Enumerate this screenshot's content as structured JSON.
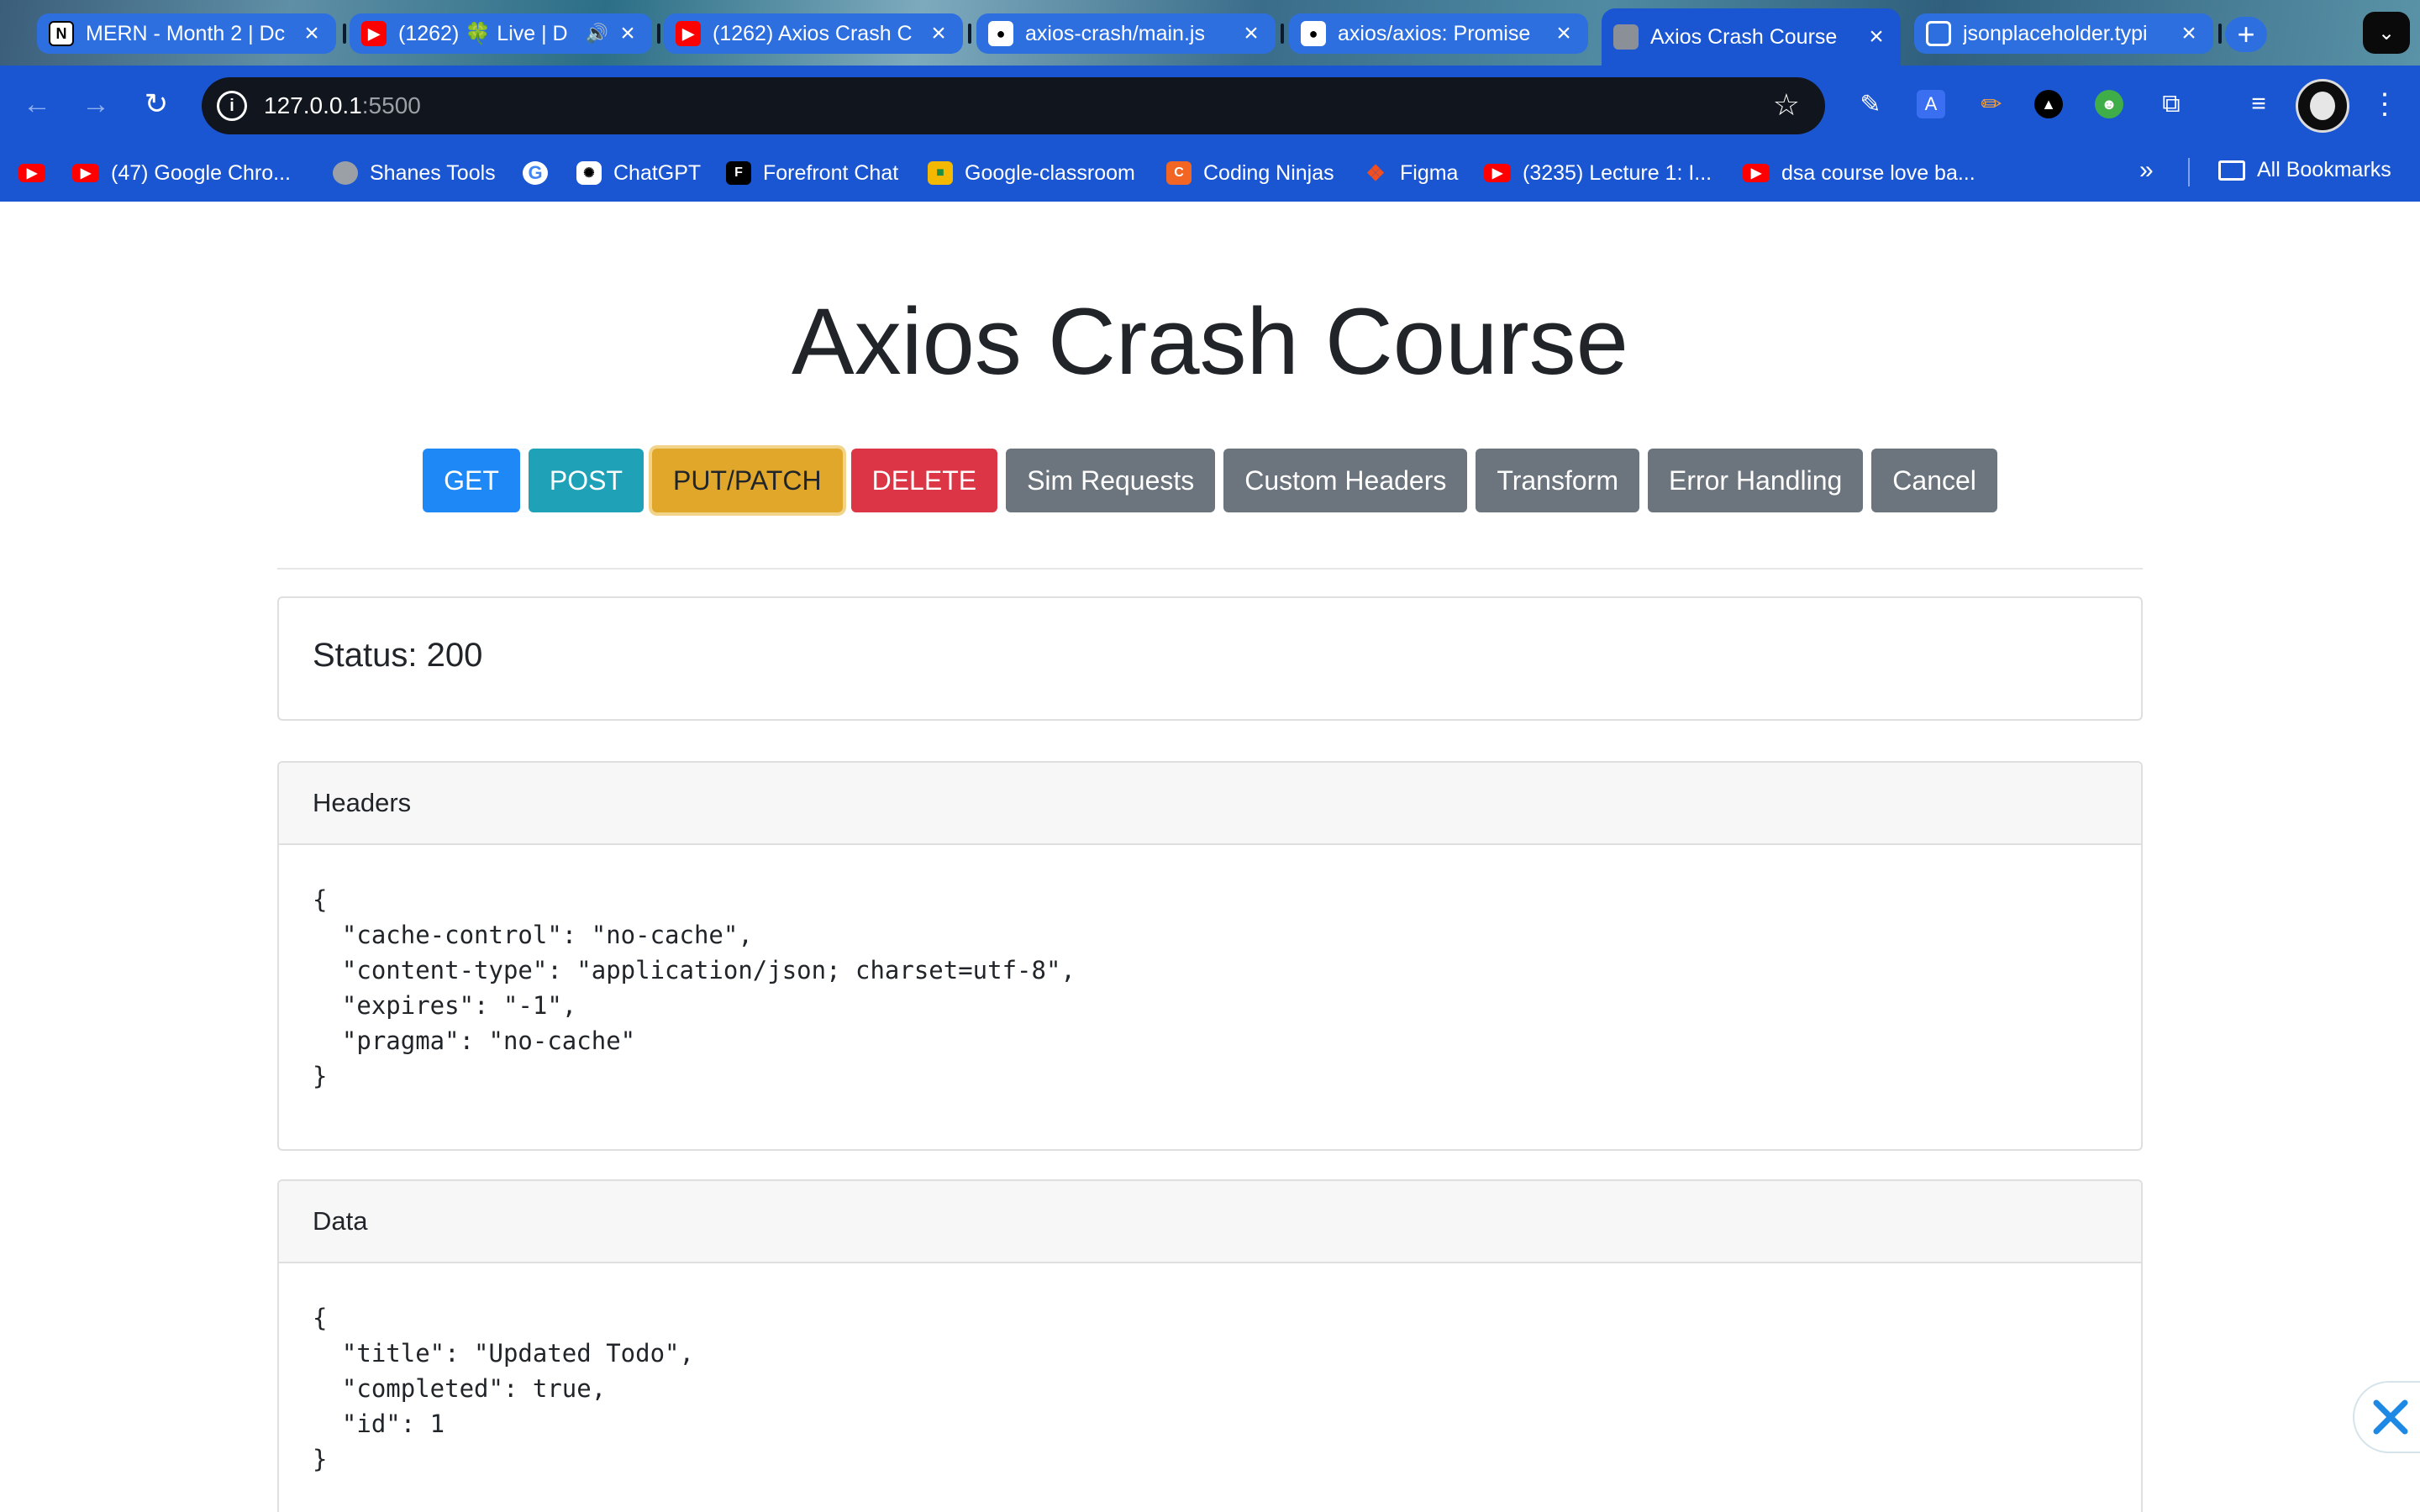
{
  "browser": {
    "tabs": [
      {
        "title": "MERN - Month 2 | Dc",
        "icon": "notion-icon"
      },
      {
        "title": "(1262) 🍀 Live | D",
        "icon": "youtube-icon"
      },
      {
        "title": "(1262) Axios Crash C",
        "icon": "youtube-icon"
      },
      {
        "title": "axios-crash/main.js",
        "icon": "github-icon"
      },
      {
        "title": "axios/axios: Promise",
        "icon": "github-icon"
      },
      {
        "title": "Axios Crash Course",
        "icon": "globe-icon",
        "active": true
      },
      {
        "title": "jsonplaceholder.typi",
        "icon": "jsonplaceholder-icon"
      }
    ],
    "new_tab_label": "+",
    "address": {
      "host": "127.0.0.1",
      "port": ":5500"
    },
    "bookmarks": [
      {
        "label": "",
        "icon": "youtube-icon"
      },
      {
        "label": "(47) Google Chro...",
        "icon": "youtube-icon"
      },
      {
        "label": "Shanes Tools",
        "icon": "globe-icon"
      },
      {
        "label": "",
        "icon": "google-icon"
      },
      {
        "label": "ChatGPT",
        "icon": "chatgpt-icon"
      },
      {
        "label": "Forefront Chat",
        "icon": "forefront-icon"
      },
      {
        "label": "Google-classroom",
        "icon": "classroom-icon"
      },
      {
        "label": "Coding Ninjas",
        "icon": "coding-ninjas-icon"
      },
      {
        "label": "Figma",
        "icon": "figma-icon"
      },
      {
        "label": "(3235) Lecture 1: I...",
        "icon": "youtube-icon"
      },
      {
        "label": "dsa course love ba...",
        "icon": "youtube-icon"
      }
    ],
    "all_bookmarks_label": "All Bookmarks"
  },
  "page": {
    "title": "Axios Crash Course",
    "buttons": [
      {
        "label": "GET",
        "style": "primary"
      },
      {
        "label": "POST",
        "style": "info"
      },
      {
        "label": "PUT/PATCH",
        "style": "warning"
      },
      {
        "label": "DELETE",
        "style": "danger"
      },
      {
        "label": "Sim Requests",
        "style": "secondary"
      },
      {
        "label": "Custom Headers",
        "style": "secondary"
      },
      {
        "label": "Transform",
        "style": "secondary"
      },
      {
        "label": "Error Handling",
        "style": "secondary"
      },
      {
        "label": "Cancel",
        "style": "secondary"
      }
    ],
    "status": "Status: 200",
    "headers_card": {
      "title": "Headers",
      "body": "{\n  \"cache-control\": \"no-cache\",\n  \"content-type\": \"application/json; charset=utf-8\",\n  \"expires\": \"-1\",\n  \"pragma\": \"no-cache\"\n}"
    },
    "data_card": {
      "title": "Data",
      "body": "{\n  \"title\": \"Updated Todo\",\n  \"completed\": true,\n  \"id\": 1\n}"
    }
  },
  "colors": {
    "chrome_blue": "#1a56d2",
    "primary": "#1e88f7",
    "info": "#1fa2b8",
    "warning": "#e0a72a",
    "danger": "#dc3545",
    "secondary": "#6c757d"
  }
}
